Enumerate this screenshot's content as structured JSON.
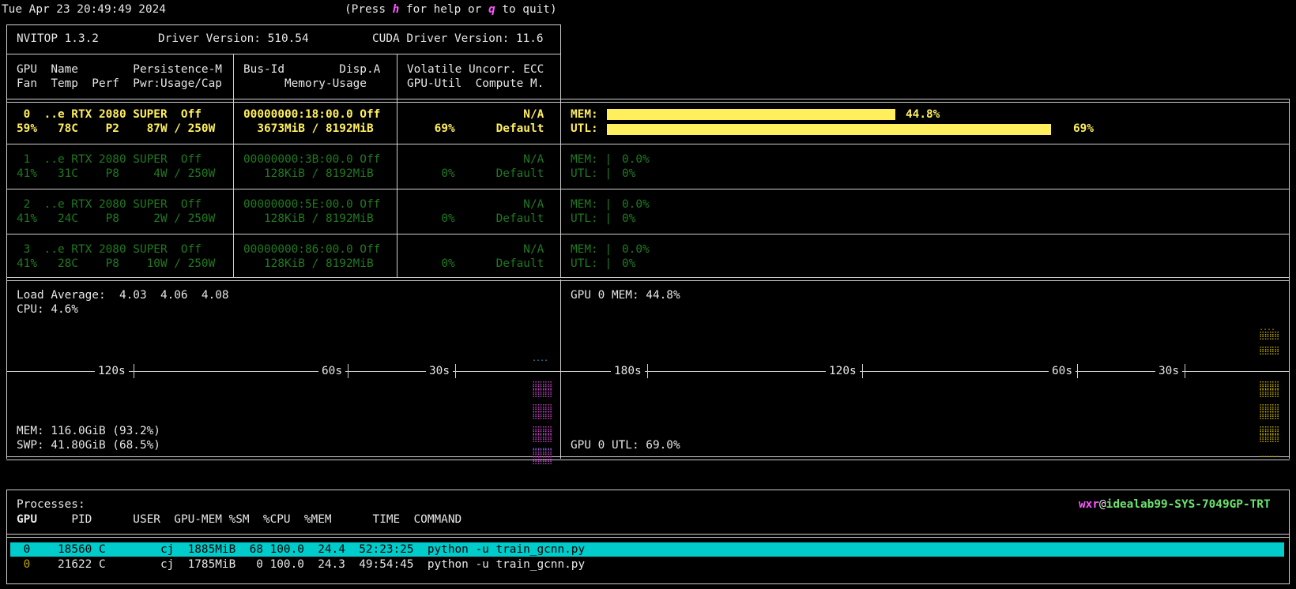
{
  "header": {
    "timestamp": "Tue Apr 23 20:49:49 2024",
    "help_prefix": "(Press ",
    "help_key": "h",
    "help_mid": " for help or ",
    "quit_key": "q",
    "help_suffix": " to quit)"
  },
  "summary": {
    "app_version": "NVITOP 1.3.2",
    "driver_version": "Driver Version: 510.54",
    "cuda_version": "CUDA Driver Version: 11.6"
  },
  "columns": {
    "row1_a": "GPU  Name        Persistence-M",
    "row2_a": "Fan  Temp  Perf  Pwr:Usage/Cap",
    "row1_b": "Bus-Id        Disp.A",
    "row2_b": "      Memory-Usage",
    "row1_c": "Volatile Uncorr. ECC",
    "row2_c": "GPU-Util  Compute M."
  },
  "gpus": [
    {
      "line1_a": " 0  ..e RTX 2080 SUPER  Off",
      "line2_a": "59%   78C    P2    87W / 250W",
      "line1_b": "00000000:18:00.0 Off",
      "line2_b": "  3673MiB / 8192MiB",
      "line1_c": "                 N/A",
      "line2_c": "    69%      Default",
      "mem_label": "MEM:",
      "mem_pct": "44.8%",
      "mem_value": 0.448,
      "utl_label": "UTL:",
      "utl_pct": "69%",
      "utl_value": 0.69
    },
    {
      "line1_a": " 1  ..e RTX 2080 SUPER  Off",
      "line2_a": "41%   31C    P8     4W / 250W",
      "line1_b": "00000000:3B:00.0 Off",
      "line2_b": "   128KiB / 8192MiB",
      "line1_c": "                 N/A",
      "line2_c": "     0%      Default",
      "mem_label": "MEM: |",
      "mem_pct": "0.0%",
      "utl_label": "UTL: |",
      "utl_pct": "0%"
    },
    {
      "line1_a": " 2  ..e RTX 2080 SUPER  Off",
      "line2_a": "41%   24C    P8     2W / 250W",
      "line1_b": "00000000:5E:00.0 Off",
      "line2_b": "   128KiB / 8192MiB",
      "line1_c": "                 N/A",
      "line2_c": "     0%      Default",
      "mem_label": "MEM: |",
      "mem_pct": "0.0%",
      "utl_label": "UTL: |",
      "utl_pct": "0%"
    },
    {
      "line1_a": " 3  ..e RTX 2080 SUPER  Off",
      "line2_a": "41%   28C    P8    10W / 250W",
      "line1_b": "00000000:86:00.0 Off",
      "line2_b": "   128KiB / 8192MiB",
      "line1_c": "                 N/A",
      "line2_c": "     0%      Default",
      "mem_label": "MEM: |",
      "mem_pct": "0.0%",
      "utl_label": "UTL: |",
      "utl_pct": "0%"
    }
  ],
  "host": {
    "load_average": "Load Average:  4.03  4.06  4.08",
    "cpu": "CPU: 4.6%",
    "mem": "MEM: 116.0GiB (93.2%)",
    "swp": "SWP: 41.80GiB (68.5%)",
    "timeline_left": [
      "120s",
      "60s",
      "30s"
    ],
    "timeline_right": [
      "180s",
      "120s",
      "60s",
      "30s"
    ],
    "gpu_mem": "GPU 0 MEM: 44.8%",
    "gpu_utl": "GPU 0 UTL: 69.0%"
  },
  "processes": {
    "title": "Processes:",
    "user": "wxr",
    "at": "@",
    "hostname": "idealab99-SYS-7049GP-TRT",
    "header_gpu": "GPU",
    "header_rest": "     PID      USER  GPU-MEM %SM  %CPU  %MEM      TIME  COMMAND",
    "rows": [
      {
        "gpu": "0",
        "rest": "   18560 C        cj  1885MiB  68 100.0  24.4  52:23:25  python -u train_gcnn.py"
      },
      {
        "gpu": "0",
        "rest": "   21622 C        cj  1785MiB   0 100.0  24.3  49:54:45  python -u train_gcnn.py"
      }
    ]
  },
  "colors": {
    "selected_row": "#00cccc",
    "bar": "#ffef5c",
    "idle_gpu": "#1f7a1f"
  }
}
